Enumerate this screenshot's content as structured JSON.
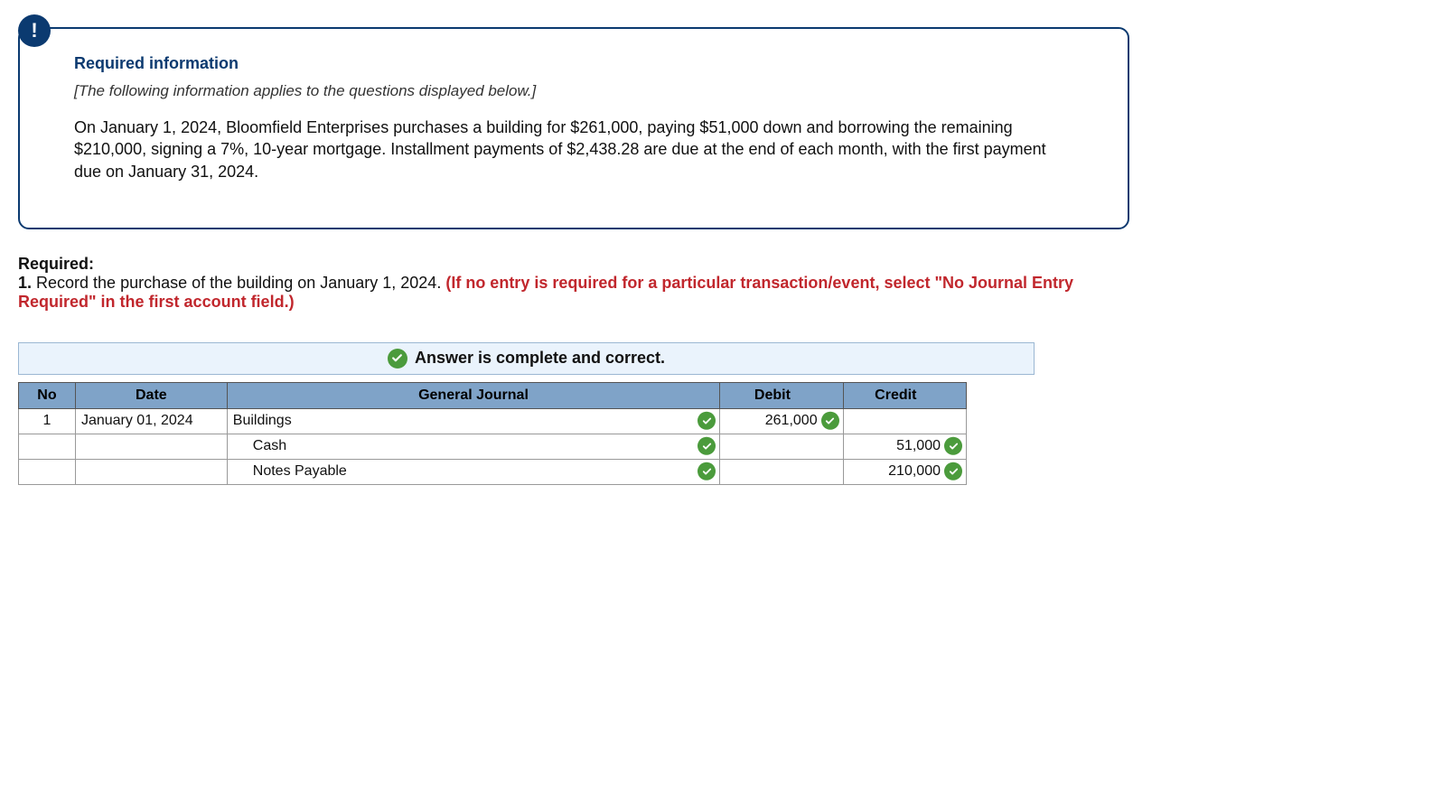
{
  "infobox": {
    "badge": "!",
    "title": "Required information",
    "note": "[The following information applies to the questions displayed below.]",
    "body": "On January 1, 2024, Bloomfield Enterprises purchases a building for $261,000, paying $51,000 down and borrowing the remaining $210,000, signing a 7%, 10-year mortgage. Installment payments of $2,438.28 are due at the end of each month, with the first payment due on January 31, 2024."
  },
  "required": {
    "label": "Required:",
    "num": "1.",
    "line1_black": " Record the purchase of the building on January 1, 2024. ",
    "hint": "(If no entry is required for a particular transaction/event, select \"No Journal Entry Required\" in the first account field.)"
  },
  "answer": {
    "banner": "Answer is complete and correct.",
    "headers": {
      "no": "No",
      "date": "Date",
      "gj": "General Journal",
      "debit": "Debit",
      "credit": "Credit"
    },
    "rows": [
      {
        "no": "1",
        "date": "January 01, 2024",
        "gj": "Buildings",
        "gj_check": true,
        "debit": "261,000",
        "debit_check": true,
        "credit": "",
        "credit_check": false,
        "indent": false
      },
      {
        "no": "",
        "date": "",
        "gj": "Cash",
        "gj_check": true,
        "debit": "",
        "debit_check": false,
        "credit": "51,000",
        "credit_check": true,
        "indent": true
      },
      {
        "no": "",
        "date": "",
        "gj": "Notes Payable",
        "gj_check": true,
        "debit": "",
        "debit_check": false,
        "credit": "210,000",
        "credit_check": true,
        "indent": true
      }
    ]
  }
}
